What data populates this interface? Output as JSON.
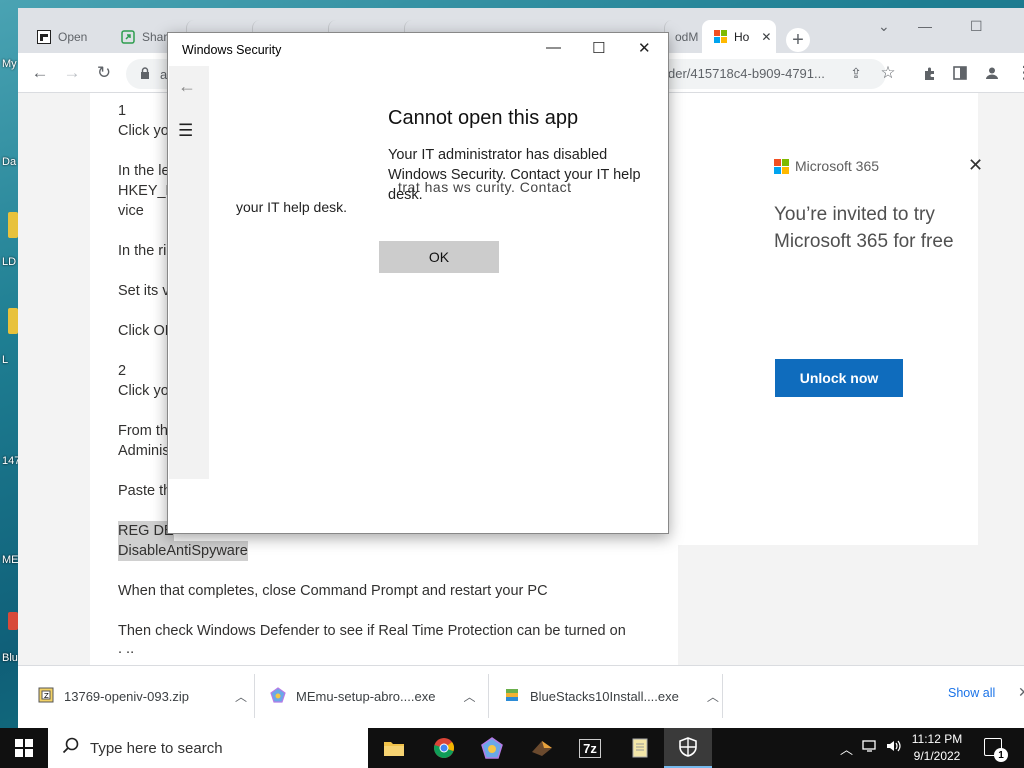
{
  "desktop": {
    "icon_labels": [
      "My",
      "Da",
      "LD",
      "L",
      "147",
      "ME",
      "Blu"
    ]
  },
  "browser": {
    "tabs": [
      {
        "label": "Open",
        "icon": "openiv-favicon-icon"
      },
      {
        "label": "Share",
        "icon": "share-favicon-icon"
      },
      {
        "label": "",
        "icon": ""
      },
      {
        "label": "",
        "icon": ""
      },
      {
        "label": "",
        "icon": ""
      },
      {
        "label": "",
        "icon": ""
      },
      {
        "label": "odM",
        "icon": ""
      },
      {
        "label": "Ho",
        "icon": "microsoft-favicon-icon",
        "active": true
      }
    ],
    "new_tab_label": "+",
    "window_controls": {
      "dropdown": "⌄",
      "minimize": "—",
      "maximize": "☐"
    },
    "toolbar": {
      "back": "←",
      "forward": "→",
      "reload": "↻",
      "omnibox_prefix": "a",
      "url_tail": "der/415718c4-b909-4791..."
    }
  },
  "article": {
    "lines": [
      "1",
      "Click yo",
      "In the le",
      "HKEY_L",
      "vice",
      "In the ri",
      "Set its v",
      "Click OK",
      "2",
      "Click yo",
      "From th",
      "Adminis",
      "Paste th",
      "REG DE",
      "DisableAntiSpyware",
      "When that completes, close Command Prompt and restart your PC",
      "Then check Windows Defender to see if Real Time Protection can be turned on",
      ". .."
    ]
  },
  "ad": {
    "brand": "Microsoft 365",
    "headline": "You’re invited to try Microsoft 365 for free",
    "cta": "Unlock now",
    "close": "✕"
  },
  "downloads": {
    "items": [
      {
        "name": "13769-openiv-093.zip"
      },
      {
        "name": "MEmu-setup-abro....exe"
      },
      {
        "name": "BlueStacks10Install....exe"
      }
    ],
    "show_all": "Show all",
    "close": "✕"
  },
  "dialog": {
    "title": "Windows Security",
    "heading": "Cannot open this app",
    "message": "Your IT administrator has disabled Windows Security. Contact your IT help desk.",
    "ghost_line1": "trat      has                       ws     curity. Contact",
    "ghost_line2": "your IT help desk.",
    "ok_label": "OK",
    "controls": {
      "minimize": "—",
      "maximize": "☐",
      "close": "✕"
    }
  },
  "taskbar": {
    "search_placeholder": "Type here to search",
    "apps": [
      {
        "name": "file-explorer"
      },
      {
        "name": "chrome"
      },
      {
        "name": "memu"
      },
      {
        "name": "app"
      },
      {
        "name": "7zip",
        "label": "7z"
      },
      {
        "name": "notepad"
      },
      {
        "name": "windows-security",
        "active": true
      }
    ],
    "time": "11:12 PM",
    "date": "9/1/2022",
    "notification_count": "1"
  },
  "colors": {
    "ms_blue": "#0f6cbd",
    "ms_red": "#f25022",
    "ms_green": "#7fba00",
    "ms_blue_logo": "#00a4ef",
    "ms_yellow": "#ffb900"
  }
}
